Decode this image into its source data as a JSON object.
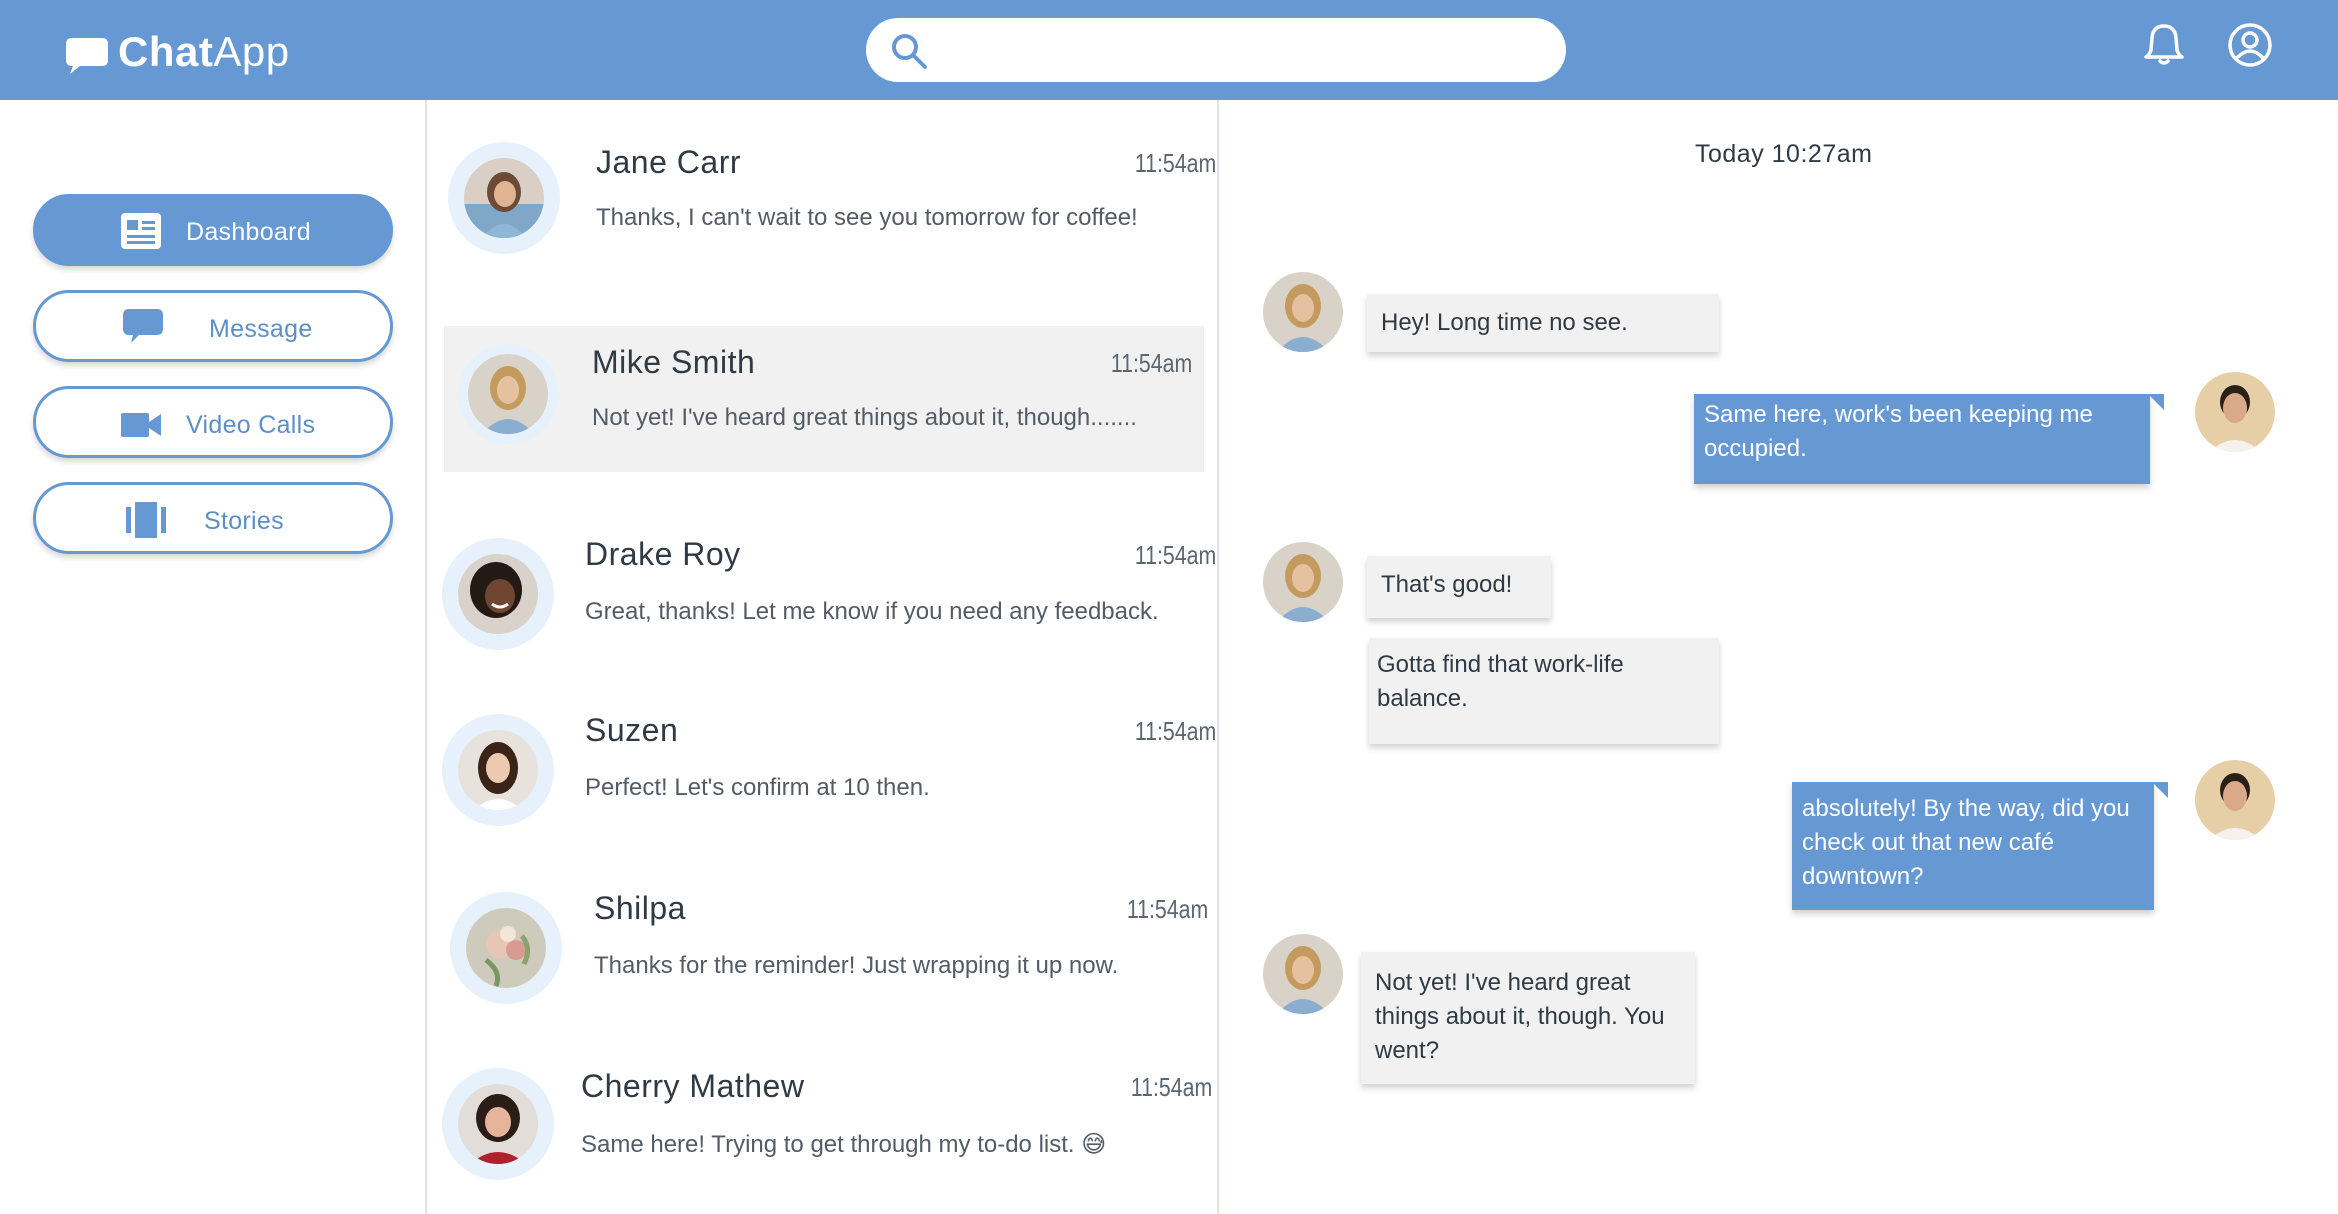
{
  "app": {
    "name_bold": "Chat",
    "name_rest": "App"
  },
  "header": {
    "search_placeholder": "",
    "icons": [
      "search-icon",
      "bell-icon",
      "account-icon"
    ]
  },
  "sidebar": {
    "items": [
      {
        "label": "Dashboard",
        "icon": "dashboard-icon",
        "active": true
      },
      {
        "label": "Message",
        "icon": "message-icon",
        "active": false
      },
      {
        "label": "Video Calls",
        "icon": "video-camera-icon",
        "active": false
      },
      {
        "label": "Stories",
        "icon": "stories-icon",
        "active": false
      }
    ]
  },
  "conversations": [
    {
      "name": "Jane Carr",
      "time": "11:54am",
      "preview": "Thanks, I can't wait to see you tomorrow for coffee!"
    },
    {
      "name": "Mike Smith",
      "time": "11:54am",
      "preview": "Not yet! I've heard great things about it, though.......",
      "selected": true
    },
    {
      "name": "Drake Roy",
      "time": "11:54am",
      "preview": "Great, thanks! Let me know if you need any feedback."
    },
    {
      "name": "Suzen",
      "time": "11:54am",
      "preview": "Perfect! Let's confirm at 10 then."
    },
    {
      "name": "Shilpa",
      "time": "11:54am",
      "preview": "Thanks for the reminder! Just wrapping it up now."
    },
    {
      "name": "Cherry Mathew",
      "time": "11:54am",
      "preview": "Same here! Trying to get through my to-do list. 😅"
    }
  ],
  "chat": {
    "date_label": "Today 10:27am",
    "messages": [
      {
        "direction": "in",
        "text": "Hey! Long time no see."
      },
      {
        "direction": "out",
        "text": "Same here, work's been keeping me occupied."
      },
      {
        "direction": "in",
        "text": "That's good!"
      },
      {
        "direction": "in",
        "text": "Gotta find that work-life balance."
      },
      {
        "direction": "out",
        "text": "absolutely! By the way, did you check out that new café downtown?"
      },
      {
        "direction": "in",
        "text": "Not yet! I've heard great things about it, though. You went?"
      }
    ]
  },
  "colors": {
    "brand": "#6699d3",
    "selected_row": "#f1f1f1",
    "avatar_ring": "#e6f1fb",
    "incoming_bubble": "#f1f1f1",
    "outgoing_bubble": "#6699d3"
  }
}
